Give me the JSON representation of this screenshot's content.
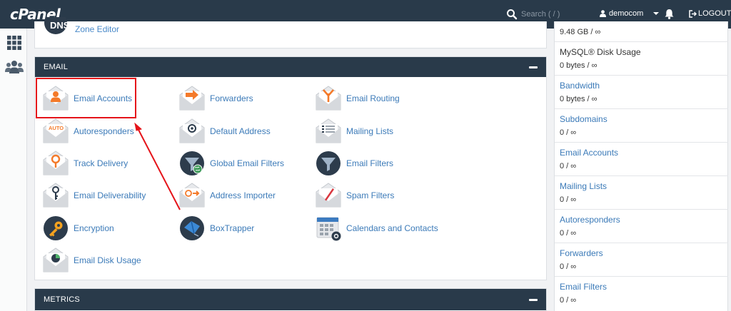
{
  "header": {
    "logo": "cPanel",
    "search_placeholder": "Search ( / )",
    "username": "democom",
    "logout_label": "LOGOUT"
  },
  "zone_editor": {
    "label": "Zone Editor"
  },
  "email_section": {
    "title": "EMAIL",
    "items": [
      {
        "label": "Email Accounts",
        "icon": "email-accounts-icon"
      },
      {
        "label": "Forwarders",
        "icon": "forwarders-icon"
      },
      {
        "label": "Email Routing",
        "icon": "email-routing-icon"
      },
      {
        "label": "Autoresponders",
        "icon": "autoresponders-icon"
      },
      {
        "label": "Default Address",
        "icon": "default-address-icon"
      },
      {
        "label": "Mailing Lists",
        "icon": "mailing-lists-icon"
      },
      {
        "label": "Track Delivery",
        "icon": "track-delivery-icon"
      },
      {
        "label": "Global Email Filters",
        "icon": "global-email-filters-icon"
      },
      {
        "label": "Email Filters",
        "icon": "email-filters-icon"
      },
      {
        "label": "Email Deliverability",
        "icon": "email-deliverability-icon"
      },
      {
        "label": "Address Importer",
        "icon": "address-importer-icon"
      },
      {
        "label": "Spam Filters",
        "icon": "spam-filters-icon"
      },
      {
        "label": "Encryption",
        "icon": "encryption-icon"
      },
      {
        "label": "BoxTrapper",
        "icon": "boxtrapper-icon"
      },
      {
        "label": "Calendars and Contacts",
        "icon": "calendars-contacts-icon"
      },
      {
        "label": "Email Disk Usage",
        "icon": "email-disk-usage-icon"
      }
    ],
    "autoresponder_badge": "AUTO"
  },
  "metrics_section": {
    "title": "METRICS"
  },
  "stats": [
    {
      "name": "",
      "value": "9.48 GB / ∞"
    },
    {
      "name": "MySQL® Disk Usage",
      "value": "0 bytes / ∞"
    },
    {
      "name": "Bandwidth",
      "value": "0 bytes / ∞"
    },
    {
      "name": "Subdomains",
      "value": "0 / ∞"
    },
    {
      "name": "Email Accounts",
      "value": "0 / ∞"
    },
    {
      "name": "Mailing Lists",
      "value": "0 / ∞"
    },
    {
      "name": "Autoresponders",
      "value": "0 / ∞"
    },
    {
      "name": "Forwarders",
      "value": "0 / ∞"
    },
    {
      "name": "Email Filters",
      "value": "0 / ∞"
    }
  ],
  "colors": {
    "topbar": "#293a4a",
    "link": "#3b7ab8",
    "highlight": "#e5141a",
    "accent_orange": "#f47a2a"
  }
}
